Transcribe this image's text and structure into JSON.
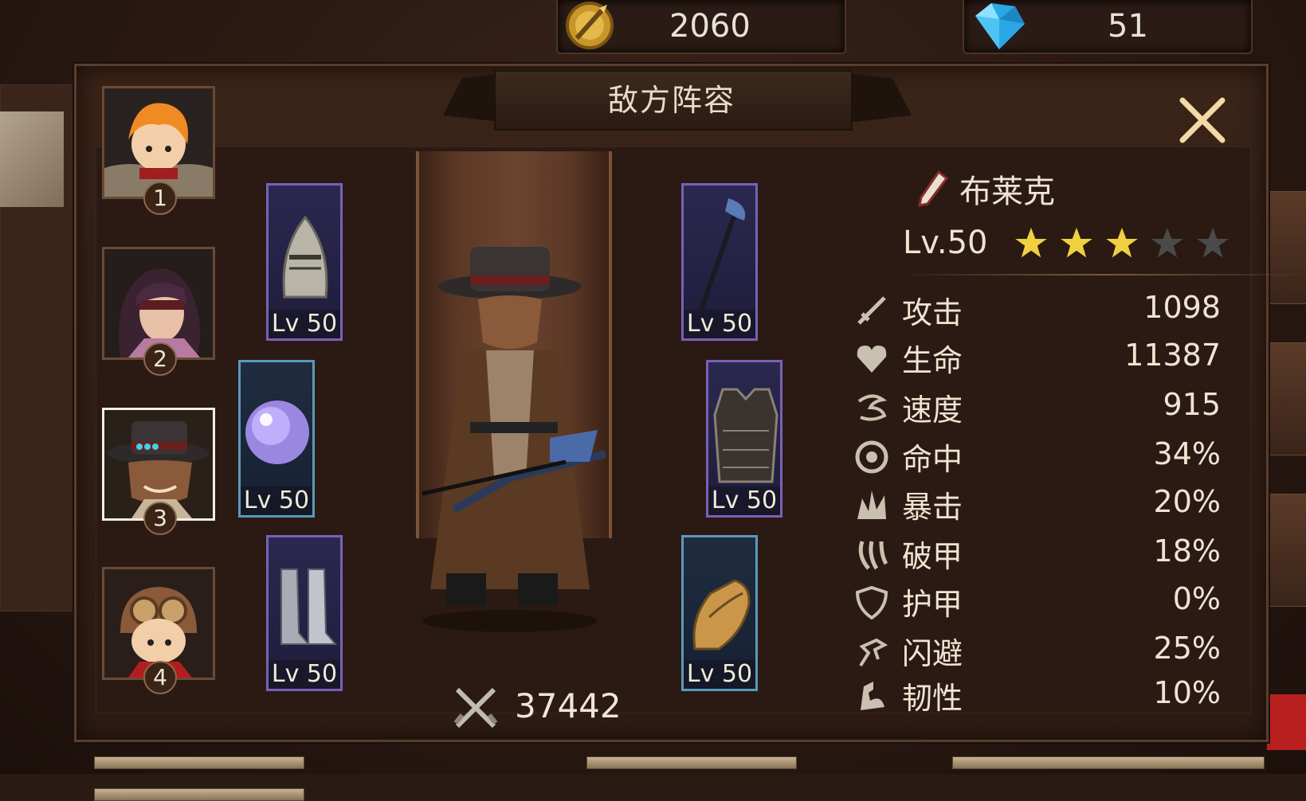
{
  "currency": {
    "gold_icon": "sword-coin-icon",
    "gold_value": "2060",
    "gem_icon": "blue-gem-icon",
    "gem_value": "51"
  },
  "panel": {
    "title": "敌方阵容",
    "close_icon": "close-x-icon"
  },
  "heroes": [
    {
      "number": "1",
      "portrait": "orange-hair-knight-portrait"
    },
    {
      "number": "2",
      "portrait": "blindfold-woman-portrait"
    },
    {
      "number": "3",
      "portrait": "hat-gunslinger-portrait",
      "selected": true
    },
    {
      "number": "4",
      "portrait": "goggles-boy-portrait"
    }
  ],
  "equipment": {
    "helmet": {
      "icon": "knight-helmet-icon",
      "level": "Lv 50"
    },
    "orb": {
      "icon": "magic-orb-icon",
      "level": "Lv 50"
    },
    "boots": {
      "icon": "armored-boots-icon",
      "level": "Lv 50"
    },
    "weapon": {
      "icon": "cane-weapon-icon",
      "level": "Lv 50"
    },
    "armor": {
      "icon": "chest-armor-icon",
      "level": "Lv 50"
    },
    "gloves": {
      "icon": "gauntlet-icon",
      "level": "Lv 50"
    }
  },
  "character": {
    "power_icon": "crossed-swords-icon",
    "power": "37442"
  },
  "hero_info": {
    "class_icon": "brush-icon",
    "name": "布莱克",
    "level": "Lv.50",
    "stars_filled": 3,
    "stars_total": 5,
    "star_color": "#f0d040",
    "star_empty_color": "#4a4a4a"
  },
  "stats": [
    {
      "icon": "sword-icon",
      "label": "攻击",
      "value": "1098"
    },
    {
      "icon": "heart-icon",
      "label": "生命",
      "value": "11387"
    },
    {
      "icon": "wind-icon",
      "label": "速度",
      "value": "915"
    },
    {
      "icon": "target-icon",
      "label": "命中",
      "value": "34%"
    },
    {
      "icon": "burst-icon",
      "label": "暴击",
      "value": "20%"
    },
    {
      "icon": "claw-icon",
      "label": "破甲",
      "value": "18%"
    },
    {
      "icon": "shield-icon",
      "label": "护甲",
      "value": "0%"
    },
    {
      "icon": "dodge-icon",
      "label": "闪避",
      "value": "25%"
    },
    {
      "icon": "muscle-icon",
      "label": "韧性",
      "value": "10%"
    }
  ]
}
